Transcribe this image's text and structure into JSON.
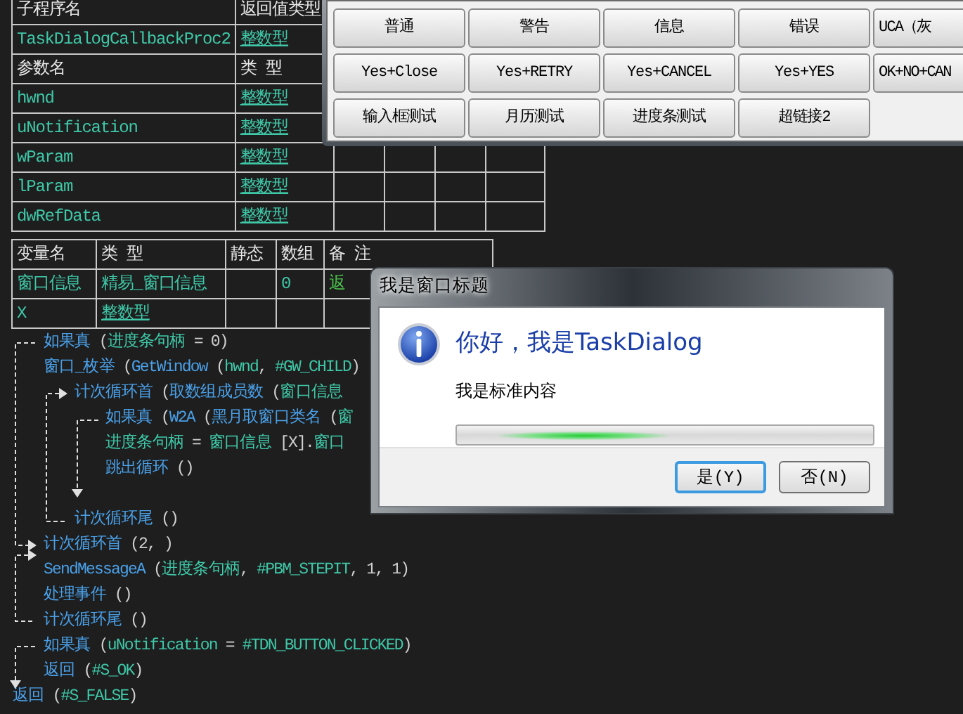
{
  "proc_table": {
    "header": [
      "子程序名",
      "返回值类型"
    ],
    "proc": {
      "name": "TaskDialogCallbackProc2",
      "type": "整数型"
    },
    "param_header": [
      "参数名",
      "类 型"
    ],
    "params": [
      {
        "name": "hwnd",
        "type": "整数型"
      },
      {
        "name": "uNotification",
        "type": "整数型"
      },
      {
        "name": "wParam",
        "type": "整数型"
      },
      {
        "name": "lParam",
        "type": "整数型"
      },
      {
        "name": "dwRefData",
        "type": "整数型"
      }
    ]
  },
  "var_table": {
    "columns": [
      "变量名",
      "类 型",
      "静态",
      "数组",
      "备 注"
    ],
    "rows": [
      {
        "name": "窗口信息",
        "type": "精易_窗口信息",
        "array": "0",
        "note": "返"
      },
      {
        "name": "X",
        "type": "整数型"
      }
    ]
  },
  "code": [
    {
      "children": [
        {
          "segments": [
            {
              "kind": "cmd",
              "text": "如果真"
            },
            {
              "kind": "plain",
              "text": " ("
            },
            {
              "kind": "name",
              "text": "进度条句柄"
            },
            {
              "kind": "plain",
              "text": " = 0)"
            }
          ]
        },
        {
          "segments": [
            {
              "kind": "cmd",
              "text": "窗口_枚举"
            },
            {
              "kind": "plain",
              "text": " ("
            },
            {
              "kind": "cmd",
              "text": "GetWindow"
            },
            {
              "kind": "plain",
              "text": " ("
            },
            {
              "kind": "name",
              "text": "hwnd"
            },
            {
              "kind": "plain",
              "text": ", "
            },
            {
              "kind": "name",
              "text": "#GW_CHILD"
            },
            {
              "kind": "plain",
              "text": ")"
            }
          ],
          "children": [
            {
              "kind": "loop",
              "segments": [
                {
                  "kind": "cmd",
                  "text": "计次循环首"
                },
                {
                  "kind": "plain",
                  "text": " ("
                },
                {
                  "kind": "cmd",
                  "text": "取数组成员数"
                },
                {
                  "kind": "plain",
                  "text": " ("
                },
                {
                  "kind": "name",
                  "text": "窗口信息"
                }
              ],
              "children": [
                {
                  "segments": [
                    {
                      "kind": "cmd",
                      "text": "如果真"
                    },
                    {
                      "kind": "plain",
                      "text": " ("
                    },
                    {
                      "kind": "cmd",
                      "text": "W2A"
                    },
                    {
                      "kind": "plain",
                      "text": " ("
                    },
                    {
                      "kind": "cmd",
                      "text": "黑月取窗口类名"
                    },
                    {
                      "kind": "plain",
                      "text": " ("
                    },
                    {
                      "kind": "name",
                      "text": "窗"
                    }
                  ]
                },
                {
                  "segments": [
                    {
                      "kind": "name",
                      "text": "进度条句柄"
                    },
                    {
                      "kind": "plain",
                      "text": " = "
                    },
                    {
                      "kind": "name",
                      "text": "窗口信息"
                    },
                    {
                      "kind": "plain",
                      "text": " [X]."
                    },
                    {
                      "kind": "name",
                      "text": "窗口"
                    }
                  ]
                },
                {
                  "segments": [
                    {
                      "kind": "cmd",
                      "text": "跳出循环"
                    },
                    {
                      "kind": "plain",
                      "text": " ()"
                    }
                  ]
                }
              ]
            },
            {
              "segments": [
                {
                  "kind": "cmd",
                  "text": "计次循环尾"
                },
                {
                  "kind": "plain",
                  "text": " ()"
                }
              ]
            }
          ]
        },
        {
          "segments": [
            {
              "kind": "cmd",
              "text": "计次循环首"
            },
            {
              "kind": "plain",
              "text": " (2, )"
            }
          ]
        },
        {
          "segments": [
            {
              "kind": "cmd",
              "text": "SendMessageA"
            },
            {
              "kind": "plain",
              "text": " ("
            },
            {
              "kind": "name",
              "text": "进度条句柄"
            },
            {
              "kind": "plain",
              "text": ", "
            },
            {
              "kind": "name",
              "text": "#PBM_STEPIT"
            },
            {
              "kind": "plain",
              "text": ", 1, 1)"
            }
          ]
        },
        {
          "segments": [
            {
              "kind": "cmd",
              "text": "处理事件"
            },
            {
              "kind": "plain",
              "text": " ()"
            }
          ]
        },
        {
          "segments": [
            {
              "kind": "cmd",
              "text": "计次循环尾"
            },
            {
              "kind": "plain",
              "text": " ()"
            }
          ]
        },
        {
          "segments": [
            {
              "kind": "cmd",
              "text": "如果真"
            },
            {
              "kind": "plain",
              "text": " ("
            },
            {
              "kind": "name",
              "text": "uNotification"
            },
            {
              "kind": "plain",
              "text": " = "
            },
            {
              "kind": "name",
              "text": "#TDN_BUTTON_CLICKED"
            },
            {
              "kind": "plain",
              "text": ")"
            }
          ]
        },
        {
          "segments": [
            {
              "kind": "cmd",
              "text": "返回"
            },
            {
              "kind": "plain",
              "text": " ("
            },
            {
              "kind": "name",
              "text": "#S_OK"
            },
            {
              "kind": "plain",
              "text": ")"
            }
          ]
        }
      ]
    },
    {
      "segments": [
        {
          "kind": "cmd",
          "text": "返回"
        },
        {
          "kind": "plain",
          "text": " ("
        },
        {
          "kind": "name",
          "text": "#S_FALSE"
        },
        {
          "kind": "plain",
          "text": ")"
        }
      ]
    }
  ],
  "button_panel": {
    "rows": [
      [
        "普通",
        "警告",
        "信息",
        "错误",
        "UCA（灰"
      ],
      [
        "Yes+Close",
        "Yes+RETRY",
        "Yes+CANCEL",
        "Yes+YES",
        "OK+NO+CAN"
      ],
      [
        "输入框测试",
        "月历测试",
        "进度条测试",
        "超链接2"
      ]
    ]
  },
  "dialog": {
    "title": "我是窗口标题",
    "main_instruction": "你好，我是TaskDialog",
    "content": "我是标准内容",
    "progress": {
      "marquee": true
    },
    "buttons": [
      {
        "label": "是(Y)",
        "default": true
      },
      {
        "label": "否(N)",
        "default": false
      }
    ]
  }
}
